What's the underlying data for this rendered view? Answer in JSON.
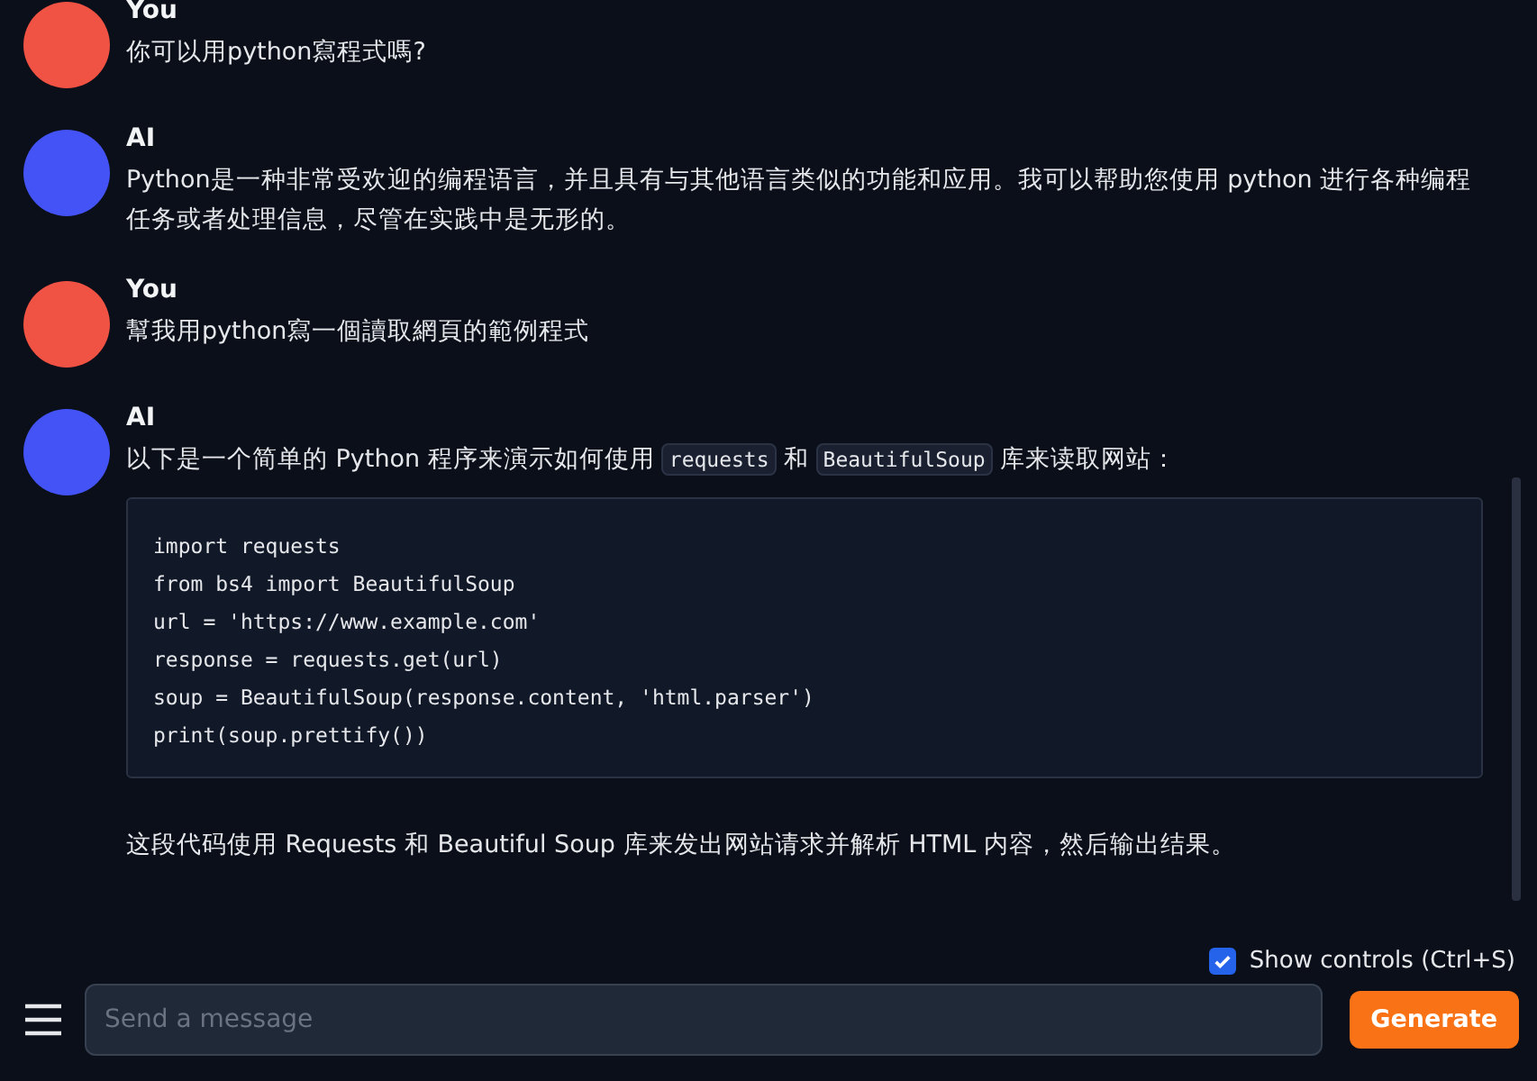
{
  "messages": [
    {
      "kind": "user",
      "name": "You",
      "blocks": [
        {
          "kind": "text",
          "segments": [
            {
              "kind": "text",
              "text": "你可以用python寫程式嗎?"
            }
          ]
        }
      ]
    },
    {
      "kind": "ai",
      "name": "AI",
      "blocks": [
        {
          "kind": "text",
          "segments": [
            {
              "kind": "text",
              "text": "Python是一种非常受欢迎的编程语言，并且具有与其他语言类似的功能和应用。我可以帮助您使用 python 进行各种编程任务或者处理信息，尽管在实践中是无形的。"
            }
          ]
        }
      ]
    },
    {
      "kind": "user",
      "name": "You",
      "blocks": [
        {
          "kind": "text",
          "segments": [
            {
              "kind": "text",
              "text": "幫我用python寫一個讀取網頁的範例程式"
            }
          ]
        }
      ]
    },
    {
      "kind": "ai",
      "name": "AI",
      "blocks": [
        {
          "kind": "text",
          "segments": [
            {
              "kind": "text",
              "text": "以下是一个简单的 Python 程序来演示如何使用"
            },
            {
              "kind": "code",
              "text": "requests"
            },
            {
              "kind": "text",
              "text": "和"
            },
            {
              "kind": "code",
              "text": "BeautifulSoup"
            },
            {
              "kind": "text",
              "text": "库来读取网站："
            }
          ]
        },
        {
          "kind": "code",
          "lines": [
            "import requests",
            "from bs4 import BeautifulSoup",
            "url = 'https://www.example.com'",
            "response = requests.get(url)",
            "soup = BeautifulSoup(response.content, 'html.parser')",
            "print(soup.prettify())"
          ]
        },
        {
          "kind": "text",
          "segments": [
            {
              "kind": "text",
              "text": "这段代码使用 Requests 和 Beautiful Soup 库来发出网站请求并解析 HTML 内容，然后输出结果。"
            }
          ]
        }
      ]
    }
  ],
  "show_controls": {
    "label": "Show controls (Ctrl+S)",
    "checked": true
  },
  "input": {
    "placeholder": "Send a message"
  },
  "generate_button": "Generate"
}
